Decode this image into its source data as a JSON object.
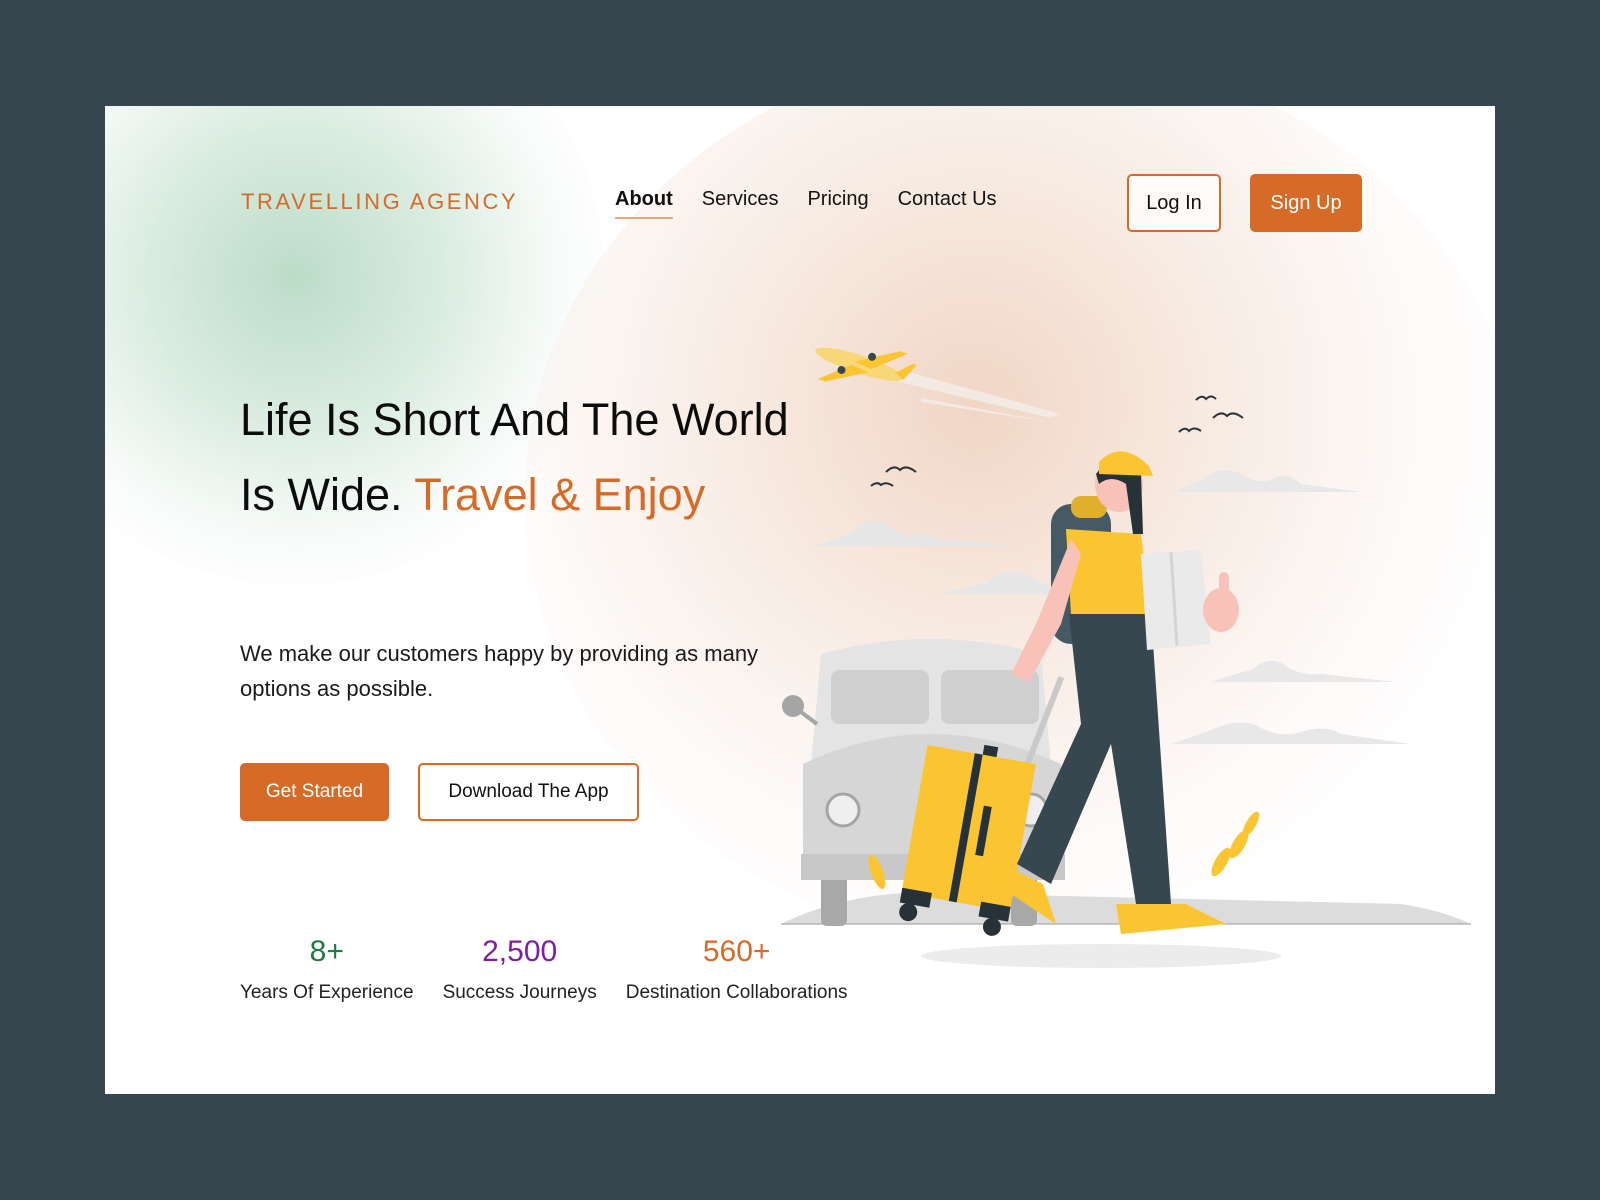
{
  "brand": {
    "name": "TRAVELLING AGENCY",
    "accent_color": "#d56b26"
  },
  "nav": {
    "items": [
      {
        "label": "About",
        "active": true
      },
      {
        "label": "Services",
        "active": false
      },
      {
        "label": "Pricing",
        "active": false
      },
      {
        "label": "Contact Us",
        "active": false
      }
    ]
  },
  "auth": {
    "login_label": "Log In",
    "signup_label": "Sign Up"
  },
  "hero": {
    "headline_part1": "Life Is Short And The World Is Wide.",
    "headline_accent": "Travel & Enjoy",
    "subtitle": "We make our customers happy by providing as many options as possible.",
    "primary_cta": "Get Started",
    "secondary_cta": "Download The App",
    "illustration": "traveler-with-suitcase-and-van-illustration"
  },
  "stats": [
    {
      "value": "8+",
      "label": "Years Of Experience",
      "color": "#1e7a3e"
    },
    {
      "value": "2,500",
      "label": "Success Journeys",
      "color": "#7a1fa2"
    },
    {
      "value": "560+",
      "label": "Destination Collaborations",
      "color": "#d56b26"
    }
  ]
}
